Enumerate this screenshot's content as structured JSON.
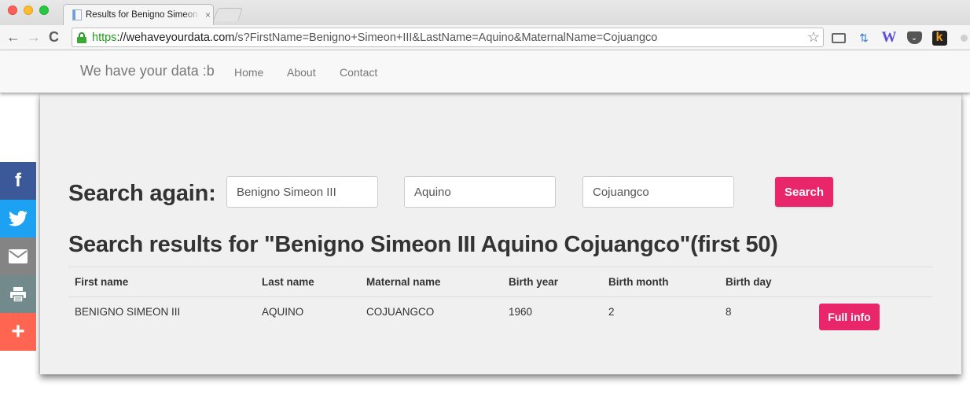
{
  "browser": {
    "tab_title": "Results for Benigno Simeon III Aquino Cojuangco",
    "tab_close": "×",
    "url_scheme": "https",
    "url_host": "://wehaveyourdata.com",
    "url_rest": "/s?FirstName=Benigno+Simeon+III&LastName=Aquino&MaternalName=Cojuangco",
    "nav": {
      "back": "←",
      "forward": "→",
      "reload": "C"
    },
    "bookmark_star": "☆",
    "extensions": {
      "arrows": "⇅",
      "w": "W",
      "pocket": "❯",
      "k": "k"
    }
  },
  "site": {
    "brand": "We have your data :b",
    "nav_links": [
      "Home",
      "About",
      "Contact"
    ]
  },
  "search": {
    "label": "Search again:",
    "first_name_value": "Benigno Simeon III",
    "last_name_value": "Aquino",
    "maternal_name_value": "Cojuangco",
    "button_label": "Search"
  },
  "results": {
    "title": "Search results for \"Benigno Simeon III Aquino Cojuangco\"(first 50)",
    "columns": [
      "First name",
      "Last name",
      "Maternal name",
      "Birth year",
      "Birth month",
      "Birth day"
    ],
    "rows": [
      {
        "first": "BENIGNO SIMEON III",
        "last": "AQUINO",
        "maternal": "COJUANGCO",
        "year": "1960",
        "month": "2",
        "day": "8",
        "action": "Full info"
      }
    ]
  },
  "share": {
    "facebook": "f",
    "more": "+"
  },
  "colors": {
    "accent": "#e9266a",
    "facebook": "#3b5998",
    "twitter": "#1da1f2",
    "email": "#848484",
    "print": "#738a8d",
    "more": "#ff6550"
  }
}
